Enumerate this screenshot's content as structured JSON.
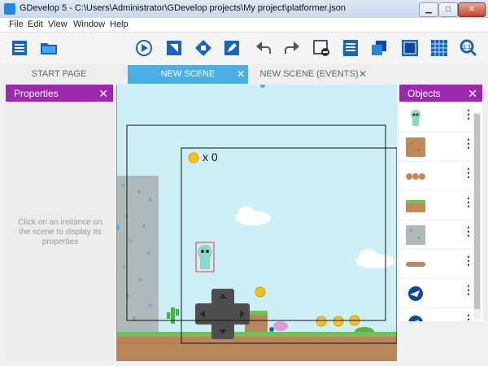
{
  "window": {
    "title": "GDevelop 5 - C:\\Users\\Administrator\\GDevelop projects\\My project\\platformer.json",
    "minimize": "▁",
    "maximize": "□",
    "close": "✕"
  },
  "menu": [
    "File",
    "Edit",
    "View",
    "Window",
    "Help"
  ],
  "toolbar": {
    "icons": [
      "project-manager-icon",
      "open-folder-icon",
      "preview-play-icon",
      "object-bring-icon",
      "object-grid-icon",
      "edit-pencil-icon",
      "undo-icon",
      "redo-icon",
      "delete-icon",
      "layers-icon",
      "instances-icon",
      "window-mask-icon",
      "grid-icon",
      "zoom-icon"
    ]
  },
  "tabs": [
    {
      "label": "START PAGE",
      "active": false,
      "closable": false
    },
    {
      "label": "NEW SCENE",
      "active": true,
      "closable": true
    },
    {
      "label": "NEW SCENE (EVENTS)",
      "active": false,
      "closable": true
    }
  ],
  "tab_close_glyph": "✕",
  "properties": {
    "title": "Properties",
    "close": "✕",
    "hint": "Click on an instance on the scene to display its properties"
  },
  "objects_panel": {
    "title": "Objects",
    "close": "✕",
    "items": [
      "player-sprite-icon",
      "dirt-block-icon",
      "bricks-icon",
      "grass-platform-icon",
      "stone-block-icon",
      "wood-plank-icon",
      "blue-coin-icon",
      "blue-ball-icon"
    ],
    "more": "⋮"
  },
  "scene": {
    "coin_counter": "x 0",
    "colors": {
      "sky": "#cdf0f7",
      "grass": "#6ec35a",
      "dirt": "#b9855a",
      "coin": "#f5c21b"
    }
  },
  "colors": {
    "accent": "#9c27b0",
    "tab_active": "#4ab0e4"
  }
}
